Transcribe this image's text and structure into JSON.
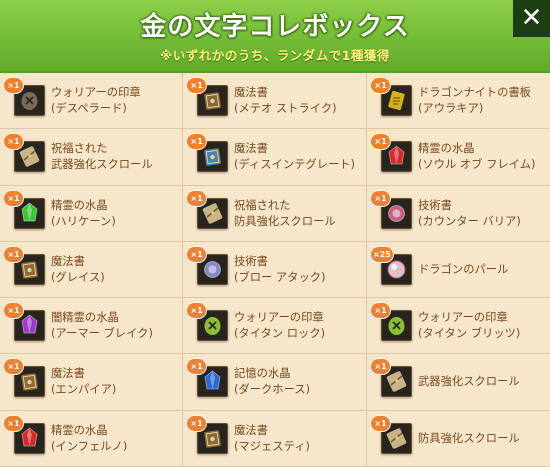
{
  "header": {
    "title": "金の文字コレボックス",
    "subtitle": "※いずれかのうち、ランダムで1種獲得",
    "close_label": "✕"
  },
  "items": [
    {
      "badge": "×1",
      "line1": "ウォリアーの印章",
      "line2": "(デスペラード)",
      "icon": "warrior-seal-icon",
      "color": "#7a6a5a"
    },
    {
      "badge": "×1",
      "line1": "魔法書",
      "line2": "(メテオ ストライク)",
      "icon": "spellbook-icon",
      "color": "#8a6a3a"
    },
    {
      "badge": "×1",
      "line1": "ドラゴンナイトの書板",
      "line2": "(アウラキア)",
      "icon": "dragon-tablet-icon",
      "color": "#d4b020"
    },
    {
      "badge": "×1",
      "line1": "祝福された",
      "line2": "武器強化スクロール",
      "icon": "scroll-icon",
      "color": "#c9b48a"
    },
    {
      "badge": "×1",
      "line1": "魔法書",
      "line2": "(ディスインテグレート)",
      "icon": "spellbook-icon",
      "color": "#4f7fb0"
    },
    {
      "badge": "×1",
      "line1": "精霊の水晶",
      "line2": "(ソウル オブ フレイム)",
      "icon": "red-crystal-icon",
      "color": "#d42a2a"
    },
    {
      "badge": "×1",
      "line1": "精霊の水晶",
      "line2": "(ハリケーン)",
      "icon": "green-crystal-icon",
      "color": "#3cc43c"
    },
    {
      "badge": "×1",
      "line1": "祝福された",
      "line2": "防具強化スクロール",
      "icon": "scroll-icon",
      "color": "#c9b48a"
    },
    {
      "badge": "×1",
      "line1": "技術書",
      "line2": "(カウンター バリア)",
      "icon": "skill-book-icon",
      "color": "#d86a8a"
    },
    {
      "badge": "×1",
      "line1": "魔法書",
      "line2": "(グレイス)",
      "icon": "spellbook-icon",
      "color": "#8a6a3a"
    },
    {
      "badge": "×1",
      "line1": "技術書",
      "line2": "(ブロー アタック)",
      "icon": "skill-book-icon",
      "color": "#8a9ad4"
    },
    {
      "badge": "×25",
      "line1": "ドラゴンのパール",
      "line2": "",
      "icon": "dragon-pearl-icon",
      "color": "#e0c0c8"
    },
    {
      "badge": "×1",
      "line1": "闇精霊の水晶",
      "line2": "(アーマー ブレイク)",
      "icon": "purple-crystal-icon",
      "color": "#9b3cc4"
    },
    {
      "badge": "×1",
      "line1": "ウォリアーの印章",
      "line2": "(タイタン ロック)",
      "icon": "warrior-seal-icon",
      "color": "#8bbf3a"
    },
    {
      "badge": "×1",
      "line1": "ウォリアーの印章",
      "line2": "(タイタン ブリッツ)",
      "icon": "warrior-seal-icon",
      "color": "#8bbf3a"
    },
    {
      "badge": "×1",
      "line1": "魔法書",
      "line2": "(エンパイア)",
      "icon": "spellbook-icon",
      "color": "#8a6a3a"
    },
    {
      "badge": "×1",
      "line1": "記憶の水晶",
      "line2": "(ダークホース)",
      "icon": "blue-crystal-icon",
      "color": "#2a6ad4"
    },
    {
      "badge": "×1",
      "line1": "武器強化スクロール",
      "line2": "",
      "icon": "scroll-icon",
      "color": "#c9b48a"
    },
    {
      "badge": "×1",
      "line1": "精霊の水晶",
      "line2": "(インフェルノ)",
      "icon": "red-crystal-icon",
      "color": "#d42a2a"
    },
    {
      "badge": "×1",
      "line1": "魔法書",
      "line2": "(マジェスティ)",
      "icon": "spellbook-icon",
      "color": "#8a6a3a"
    },
    {
      "badge": "×1",
      "line1": "防具強化スクロール",
      "line2": "",
      "icon": "scroll-icon",
      "color": "#c9b48a"
    }
  ]
}
